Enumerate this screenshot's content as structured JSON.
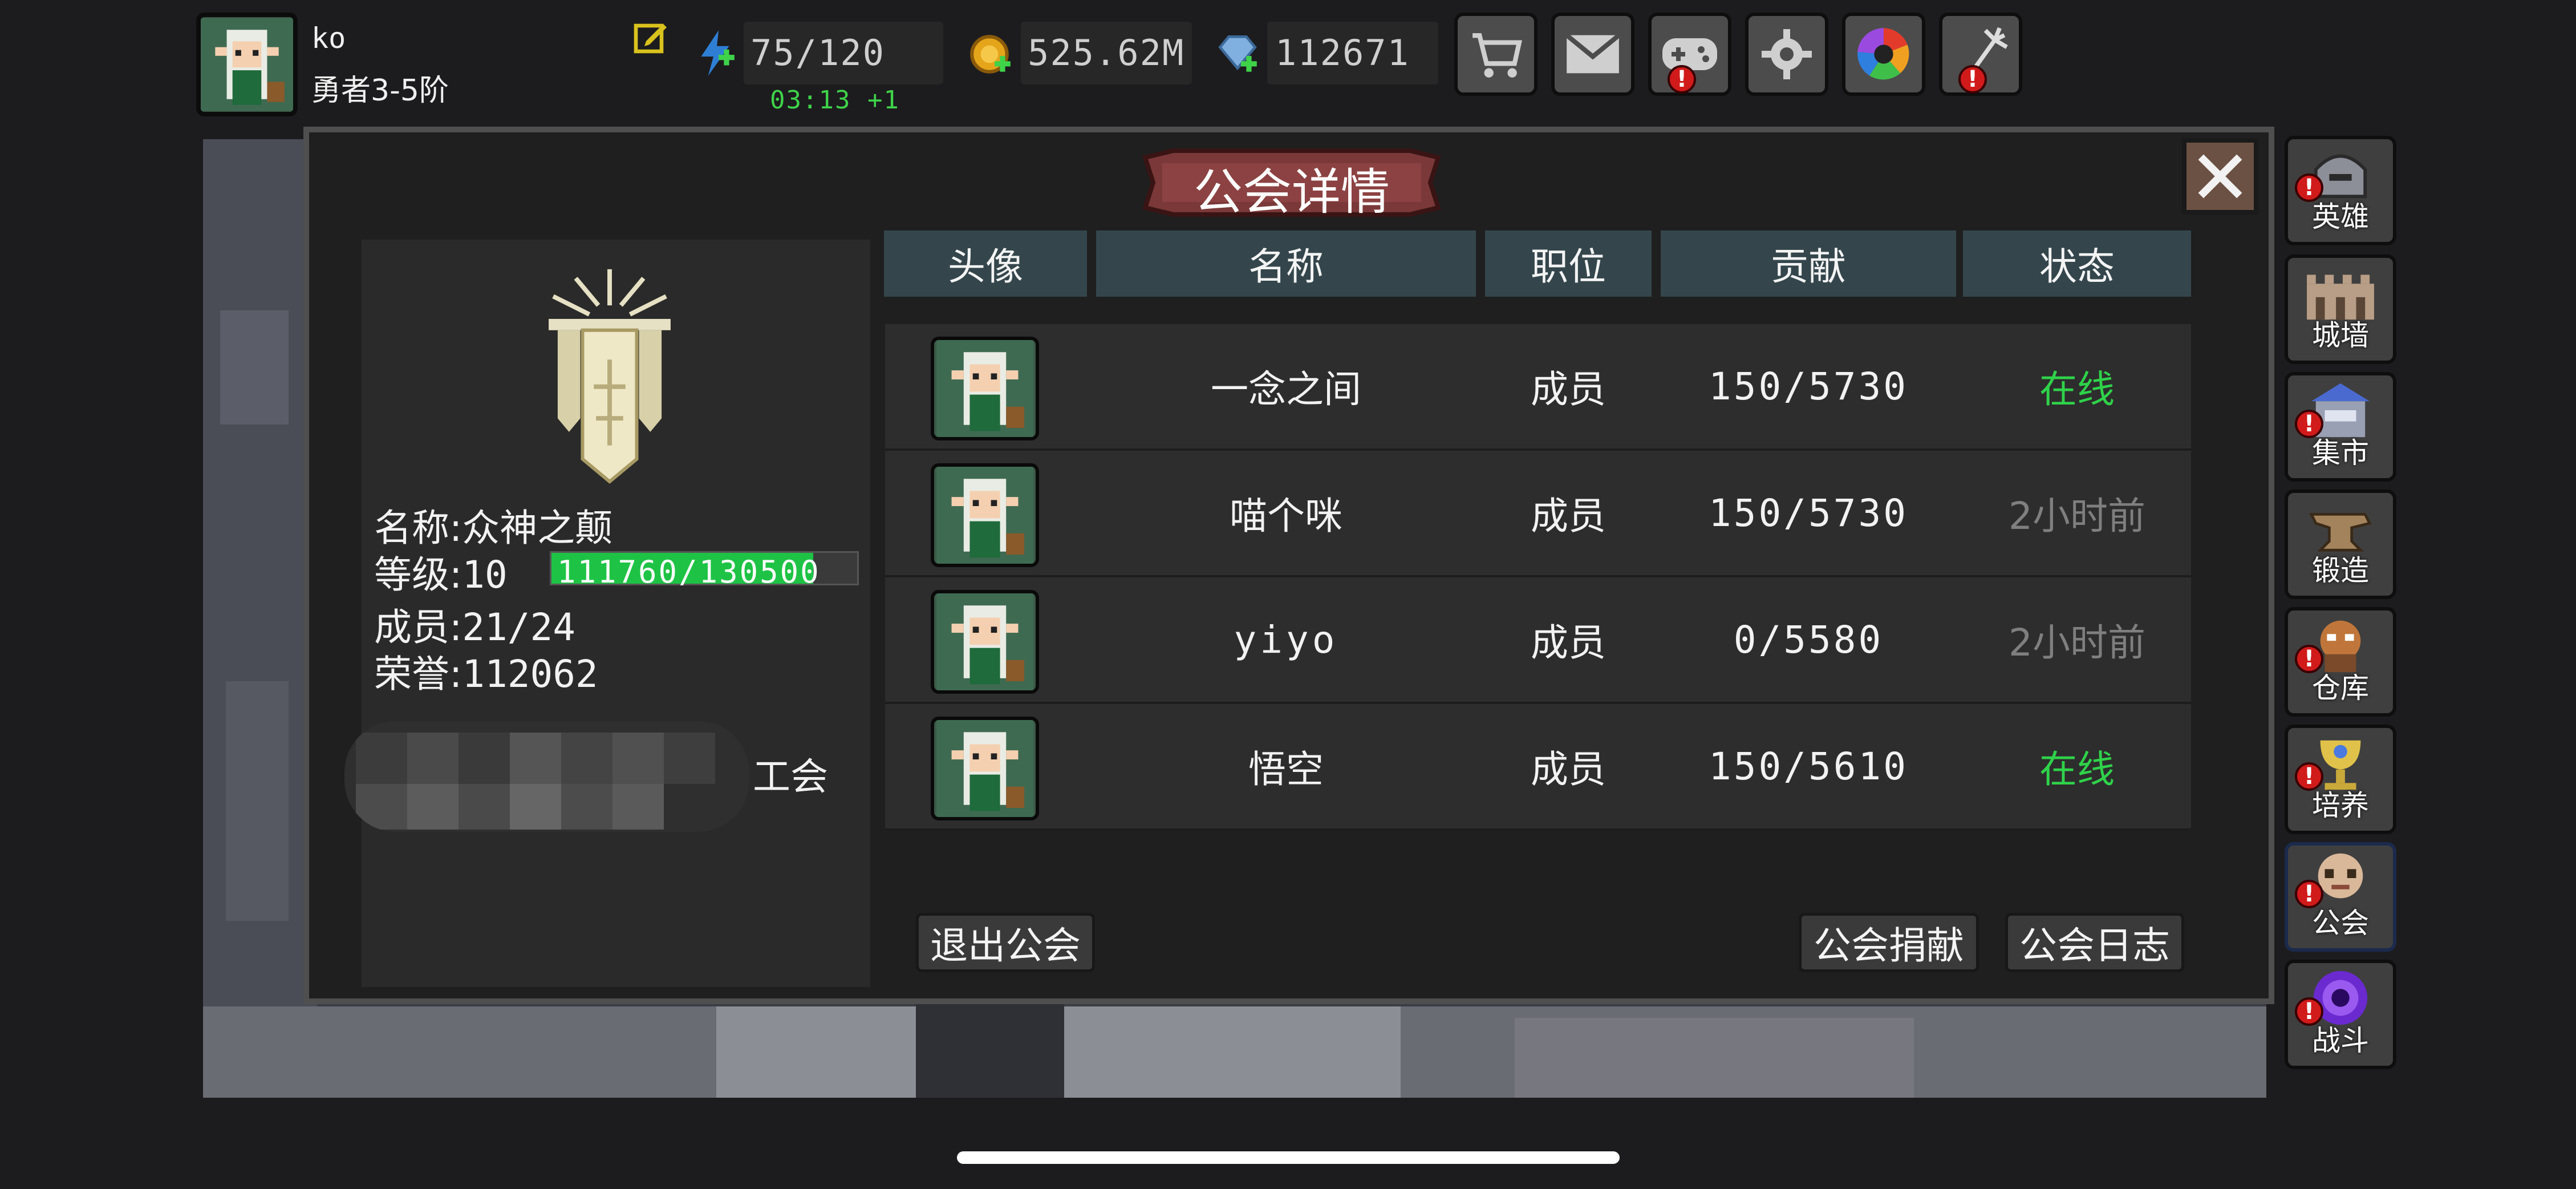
{
  "player": {
    "name": "ko",
    "rank": "勇者3-5阶",
    "stamina": "75/120",
    "stamina_timer": "03:13 +1",
    "gold": "525.62M",
    "gems": "112671"
  },
  "top_buttons": [
    {
      "icon": "cart-icon",
      "alert": false
    },
    {
      "icon": "mail-icon",
      "alert": false
    },
    {
      "icon": "gamepad-icon",
      "alert": true
    },
    {
      "icon": "gear-icon",
      "alert": false
    },
    {
      "icon": "color-wheel-icon",
      "alert": false
    },
    {
      "icon": "fireworks-icon",
      "alert": true
    }
  ],
  "dialog": {
    "title": "公会详情",
    "close_glyph": "✕"
  },
  "guild": {
    "name_label": "名称:",
    "name": "众神之颠",
    "level_label": "等级:",
    "level": "10",
    "xp": "111760/130500",
    "xp_progress": 0.856,
    "members_label": "成员:",
    "members": "21/24",
    "honor_label": "荣誉:",
    "honor": "112062",
    "blurred_suffix": "工会"
  },
  "table": {
    "headers": [
      "头像",
      "名称",
      "职位",
      "贡献",
      "状态"
    ],
    "rows": [
      {
        "name": "一念之间",
        "role": "成员",
        "contribution": "150/5730",
        "status": "在线",
        "online": true
      },
      {
        "name": "喵个咪",
        "role": "成员",
        "contribution": "150/5730",
        "status": "2小时前",
        "online": false
      },
      {
        "name": "yiyo",
        "role": "成员",
        "contribution": "0/5580",
        "status": "2小时前",
        "online": false
      },
      {
        "name": "悟空",
        "role": "成员",
        "contribution": "150/5610",
        "status": "在线",
        "online": true
      }
    ]
  },
  "actions": {
    "leave": "退出公会",
    "donate": "公会捐献",
    "log": "公会日志"
  },
  "side_menu": [
    {
      "label": "英雄",
      "alert": true
    },
    {
      "label": "城墙",
      "alert": false
    },
    {
      "label": "集市",
      "alert": true
    },
    {
      "label": "锻造",
      "alert": false
    },
    {
      "label": "仓库",
      "alert": true
    },
    {
      "label": "培养",
      "alert": true
    },
    {
      "label": "公会",
      "alert": true
    },
    {
      "label": "战斗",
      "alert": true
    }
  ],
  "colors": {
    "online": "#2fd24a",
    "offline": "#7f7f7f",
    "xp_fill": "#1ec345",
    "header_bg": "#34464c",
    "alert": "#d11a1a"
  }
}
